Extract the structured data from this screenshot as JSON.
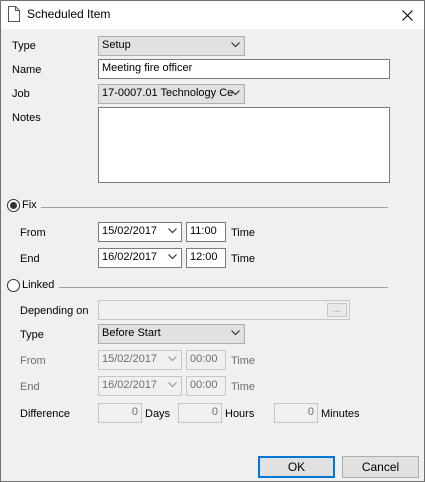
{
  "window": {
    "title": "Scheduled Item"
  },
  "form": {
    "type_label": "Type",
    "type_value": "Setup",
    "name_label": "Name",
    "name_value": "Meeting fire officer",
    "job_label": "Job",
    "job_value": "17-0007.01 Technology Ce",
    "notes_label": "Notes",
    "notes_value": ""
  },
  "fix": {
    "label": "Fix",
    "selected": true,
    "from_label": "From",
    "from_date": "15/02/2017",
    "from_time": "11:00",
    "end_label": "End",
    "end_date": "16/02/2017",
    "end_time": "12:00",
    "time_label": "Time"
  },
  "linked": {
    "label": "Linked",
    "selected": false,
    "depending_on_label": "Depending on",
    "depending_on_value": "",
    "browse_label": "...",
    "type_label": "Type",
    "type_value": "Before Start",
    "from_label": "From",
    "from_date": "15/02/2017",
    "from_time": "00:00",
    "end_label": "End",
    "end_date": "16/02/2017",
    "end_time": "00:00",
    "time_label": "Time",
    "difference_label": "Difference",
    "days_value": "0",
    "days_label": "Days",
    "hours_value": "0",
    "hours_label": "Hours",
    "minutes_value": "0",
    "minutes_label": "Minutes"
  },
  "buttons": {
    "ok": "OK",
    "cancel": "Cancel"
  },
  "icons": {
    "title": "document-icon",
    "close": "close-icon",
    "dropdown": "chevron-down-icon"
  }
}
